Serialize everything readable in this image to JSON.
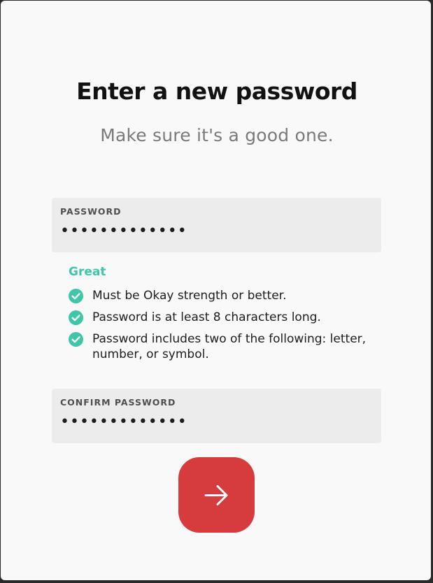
{
  "header": {
    "title": "Enter a new password",
    "subtitle": "Make sure it's a good one."
  },
  "password_field": {
    "label": "PASSWORD",
    "value": "•••••••••••••"
  },
  "strength": {
    "label": "Great",
    "color": "#3fc6a8"
  },
  "requirements": [
    {
      "text": "Must be Okay strength or better.",
      "status": "met"
    },
    {
      "text": "Password is at least 8 characters long.",
      "status": "met"
    },
    {
      "text": "Password includes two of the following: letter, number, or symbol.",
      "status": "met"
    }
  ],
  "confirm_field": {
    "label": "CONFIRM PASSWORD",
    "value": "•••••••••••••"
  },
  "submit_button": {
    "icon": "arrow-right-icon",
    "color": "#d63b3e"
  }
}
